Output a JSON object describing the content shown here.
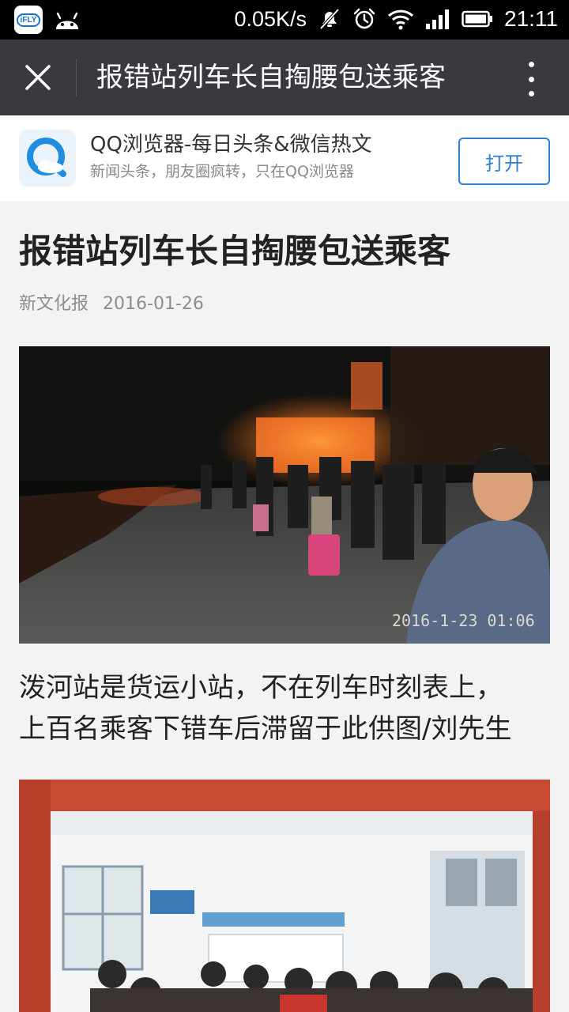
{
  "status_bar": {
    "app_icon_text": "iFLY",
    "net_speed": "0.05K/s",
    "time": "21:11",
    "icons": [
      "ifly-app-icon",
      "android-icon",
      "mute-icon",
      "alarm-icon",
      "wifi-icon",
      "signal-icon",
      "battery-icon"
    ]
  },
  "title_bar": {
    "title": "报错站列车长自掏腰包送乘客",
    "icons": [
      "close-icon",
      "more-icon"
    ]
  },
  "promo": {
    "title": "QQ浏览器-每日头条&微信热文",
    "subtitle": "新闻头条，朋友圈疯转，只在QQ浏览器",
    "open_label": "打开",
    "icon": "qq-browser-icon",
    "accent": "#2f7fd3"
  },
  "article": {
    "title": "报错站列车长自掏腰包送乘客",
    "source": "新文化报",
    "date": "2016-01-26",
    "photo1_timestamp": "2016-1-23 01:06",
    "caption_lines": [
      "泼河站是货运小站，不在列车时刻表上，",
      "上百名乘客下错车后滞留于此供图/刘先生"
    ]
  },
  "colors": {
    "status_bar_bg": "#000000",
    "title_bar_bg": "#393a3f",
    "page_bg": "#f3f3f3",
    "text": "#222222",
    "meta_text": "#8c8c8c"
  }
}
